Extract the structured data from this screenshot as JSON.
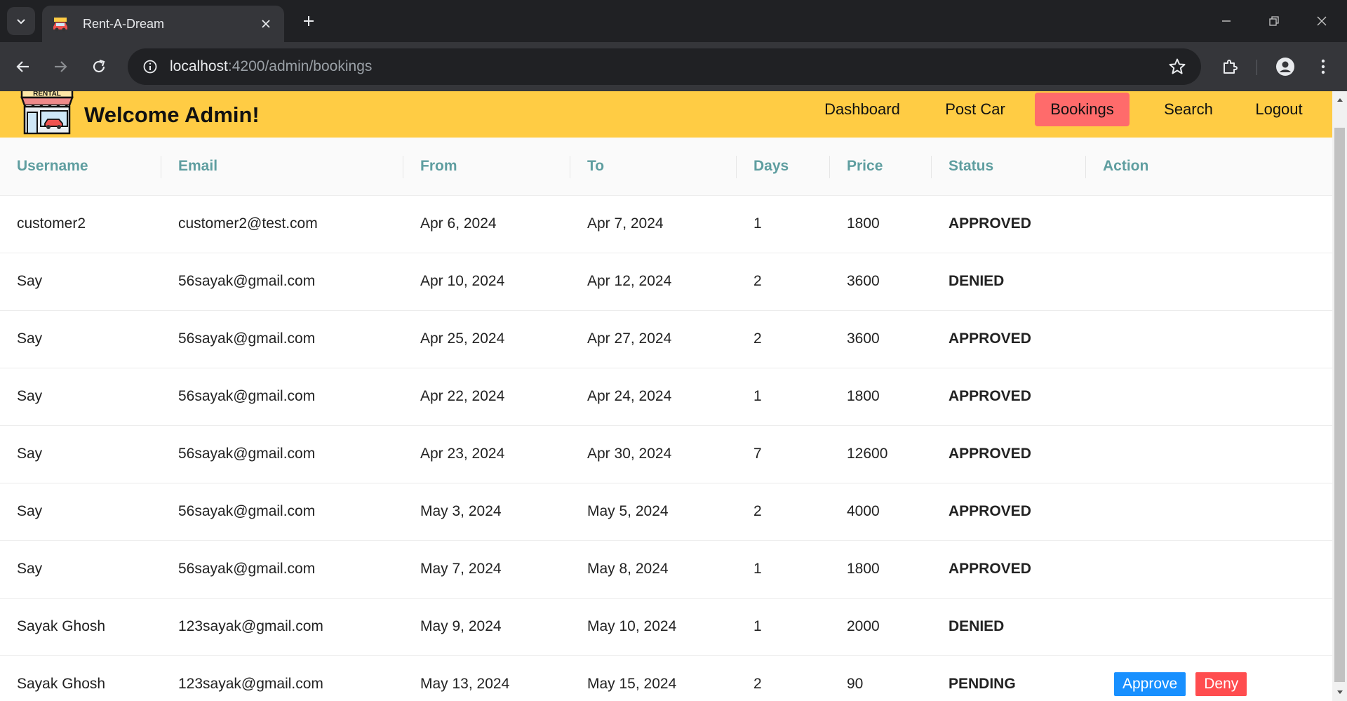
{
  "browser": {
    "tab_title": "Rent-A-Dream",
    "url_host": "localhost",
    "url_path": ":4200/admin/bookings"
  },
  "header": {
    "logo_text": "RENTAL",
    "welcome": "Welcome Admin!",
    "nav": [
      {
        "label": "Dashboard",
        "active": false
      },
      {
        "label": "Post Car",
        "active": false
      },
      {
        "label": "Bookings",
        "active": true
      },
      {
        "label": "Search",
        "active": false
      },
      {
        "label": "Logout",
        "active": false
      }
    ]
  },
  "table": {
    "columns": [
      "Username",
      "Email",
      "From",
      "To",
      "Days",
      "Price",
      "Status",
      "Action"
    ],
    "rows": [
      {
        "username": "customer2",
        "email": "customer2@test.com",
        "from": "Apr 6, 2024",
        "to": "Apr 7, 2024",
        "days": "1",
        "price": "1800",
        "status": "APPROVED"
      },
      {
        "username": "Say",
        "email": "56sayak@gmail.com",
        "from": "Apr 10, 2024",
        "to": "Apr 12, 2024",
        "days": "2",
        "price": "3600",
        "status": "DENIED"
      },
      {
        "username": "Say",
        "email": "56sayak@gmail.com",
        "from": "Apr 25, 2024",
        "to": "Apr 27, 2024",
        "days": "2",
        "price": "3600",
        "status": "APPROVED"
      },
      {
        "username": "Say",
        "email": "56sayak@gmail.com",
        "from": "Apr 22, 2024",
        "to": "Apr 24, 2024",
        "days": "1",
        "price": "1800",
        "status": "APPROVED"
      },
      {
        "username": "Say",
        "email": "56sayak@gmail.com",
        "from": "Apr 23, 2024",
        "to": "Apr 30, 2024",
        "days": "7",
        "price": "12600",
        "status": "APPROVED"
      },
      {
        "username": "Say",
        "email": "56sayak@gmail.com",
        "from": "May 3, 2024",
        "to": "May 5, 2024",
        "days": "2",
        "price": "4000",
        "status": "APPROVED"
      },
      {
        "username": "Say",
        "email": "56sayak@gmail.com",
        "from": "May 7, 2024",
        "to": "May 8, 2024",
        "days": "1",
        "price": "1800",
        "status": "APPROVED"
      },
      {
        "username": "Sayak Ghosh",
        "email": "123sayak@gmail.com",
        "from": "May 9, 2024",
        "to": "May 10, 2024",
        "days": "1",
        "price": "2000",
        "status": "DENIED"
      },
      {
        "username": "Sayak Ghosh",
        "email": "123sayak@gmail.com",
        "from": "May 13, 2024",
        "to": "May 15, 2024",
        "days": "2",
        "price": "90",
        "status": "PENDING",
        "actions": [
          "Approve",
          "Deny"
        ]
      }
    ]
  },
  "colors": {
    "header_bg": "#ffcc44",
    "active_nav": "#ff6b6b",
    "column_header_text": "#5f9ea0",
    "approved": "#008000",
    "denied": "#e51616",
    "approve_button": "#1890ff",
    "deny_button": "#ff4d4f"
  }
}
